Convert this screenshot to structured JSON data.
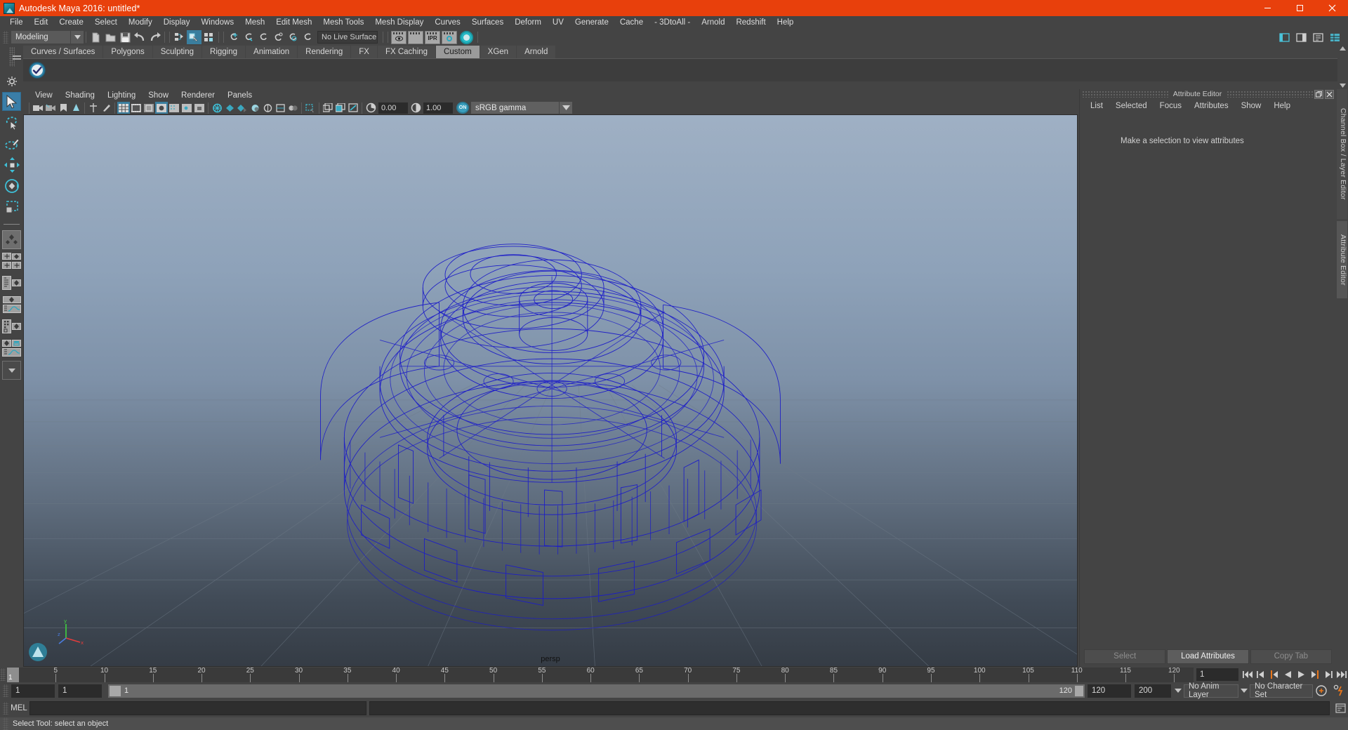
{
  "window": {
    "title": "Autodesk Maya 2016: untitled*",
    "minimize_label": "minimize",
    "maximize_label": "maximize",
    "close_label": "close"
  },
  "menubar": {
    "items": [
      "File",
      "Edit",
      "Create",
      "Select",
      "Modify",
      "Display",
      "Windows",
      "Mesh",
      "Edit Mesh",
      "Mesh Tools",
      "Mesh Display",
      "Curves",
      "Surfaces",
      "Deform",
      "UV",
      "Generate",
      "Cache",
      "- 3DtoAll -",
      "Arnold",
      "Redshift",
      "Help"
    ]
  },
  "statusline": {
    "mode": "Modeling",
    "live_surface": "No Live Surface",
    "ipr_label": "IPR",
    "icons": [
      "new-scene-icon",
      "open-scene-icon",
      "save-scene-icon",
      "undo-icon",
      "redo-icon",
      "select-hierarchy-icon",
      "select-object-icon",
      "select-component-icon",
      "snap-to-grid-icon",
      "snap-to-curve-icon",
      "snap-to-point-icon",
      "snap-to-projected-center-icon",
      "snap-to-view-plane-icon",
      "make-live-icon",
      "render-current-frame-icon",
      "render-sequence-icon",
      "ipr-render-icon",
      "render-settings-icon",
      "hypershade-icon"
    ],
    "right_icons": [
      "show-hide-ui-icon",
      "channel-box-toggle-icon",
      "attribute-editor-toggle-icon",
      "tool-settings-toggle-icon"
    ]
  },
  "shelf": {
    "tabs": [
      "Curves / Surfaces",
      "Polygons",
      "Sculpting",
      "Rigging",
      "Animation",
      "Rendering",
      "FX",
      "FX Caching",
      "Custom",
      "XGen",
      "Arnold"
    ],
    "active_tab": "Custom",
    "items": [
      {
        "name": "custom-shelf-tool",
        "label": ""
      }
    ]
  },
  "toolbox": {
    "tools": [
      {
        "name": "select-tool",
        "label": "Select Tool",
        "selected": true
      },
      {
        "name": "lasso-select-tool",
        "label": "Lasso Select Tool",
        "selected": false
      },
      {
        "name": "paint-select-tool",
        "label": "Paint Select Tool",
        "selected": false
      },
      {
        "name": "move-tool",
        "label": "Move Tool",
        "selected": false
      },
      {
        "name": "rotate-tool",
        "label": "Rotate Tool",
        "selected": false
      },
      {
        "name": "scale-tool",
        "label": "Scale Tool",
        "selected": false
      }
    ],
    "layouts": [
      "single-perspective-layout",
      "four-view-layout",
      "outliner-persp-layout",
      "persp-graph-layout",
      "hypershade-persp-layout",
      "persp-graph-outliner-layout",
      "more-layouts-dropdown"
    ]
  },
  "viewport": {
    "menus": [
      "View",
      "Shading",
      "Lighting",
      "Show",
      "Renderer",
      "Panels"
    ],
    "camera_label": "persp",
    "toolbar": {
      "exposure_value": "0.00",
      "gamma_value": "1.00",
      "color_management": "sRGB gamma",
      "color_management_on": "ON",
      "icons": [
        "select-camera-icon",
        "bookmarks-icon",
        "image-plane-icon",
        "grid-toggle-icon",
        "film-gate-icon",
        "resolution-gate-icon",
        "gate-mask-icon",
        "xray-icon",
        "xray-joints-icon",
        "xray-active-components-icon",
        "wireframe-icon",
        "smooth-shade-all-icon",
        "smooth-shade-selected-icon",
        "flat-shade-icon",
        "wireframe-on-shaded-icon",
        "texture-icon",
        "lights-icon",
        "shadows-icon",
        "screen-space-ao-icon",
        "motion-blur-icon",
        "multisample-icon",
        "depth-of-field-icon",
        "isolate-select-icon",
        "single-perspective-icon",
        "two-panes-icon",
        "four-panes-icon",
        "exposure-icon",
        "contrast-icon"
      ]
    }
  },
  "attribute_editor": {
    "panel_title": "Attribute Editor",
    "menus": [
      "List",
      "Selected",
      "Focus",
      "Attributes",
      "Show",
      "Help"
    ],
    "message": "Make a selection to view attributes",
    "buttons": [
      {
        "label": "Select",
        "enabled": false
      },
      {
        "label": "Load Attributes",
        "enabled": true
      },
      {
        "label": "Copy Tab",
        "enabled": false
      }
    ],
    "window_icons": [
      "undock-icon",
      "close-icon"
    ]
  },
  "vertical_tabs": [
    {
      "label": "Channel Box / Layer Editor",
      "active": false
    },
    {
      "label": "Attribute Editor",
      "active": true
    }
  ],
  "time_slider": {
    "current_frame": "1",
    "current_frame_field": "1",
    "ticks": [
      5,
      10,
      15,
      20,
      25,
      30,
      35,
      40,
      45,
      50,
      55,
      60,
      65,
      70,
      75,
      80,
      85,
      90,
      95,
      100,
      105,
      110,
      115,
      120
    ],
    "playback_buttons": [
      "go-to-start-icon",
      "step-back-keyframe-icon",
      "step-back-frame-icon",
      "play-backwards-icon",
      "play-forwards-icon",
      "step-forward-frame-icon",
      "step-forward-keyframe-icon",
      "go-to-end-icon"
    ]
  },
  "range_slider": {
    "anim_start": "1",
    "range_start": "1",
    "bar_start_label": "1",
    "bar_end_label": "120",
    "range_end": "120",
    "anim_end": "200",
    "anim_layer": "No Anim Layer",
    "character_set": "No Character Set",
    "auto_key_icon": "auto-keyframe-icon",
    "anim_prefs_icon": "animation-preferences-icon"
  },
  "command_line": {
    "language": "MEL",
    "input_value": "",
    "output_value": "",
    "script_editor_icon": "script-editor-icon"
  },
  "help_line": {
    "text": "Select Tool: select an object"
  },
  "colors": {
    "title_bar": "#e8400c",
    "chrome": "#444444",
    "accent_teal": "#3a7e9e",
    "wireframe_blue": "#1e1ec8",
    "orange_accent": "#e8751a"
  }
}
